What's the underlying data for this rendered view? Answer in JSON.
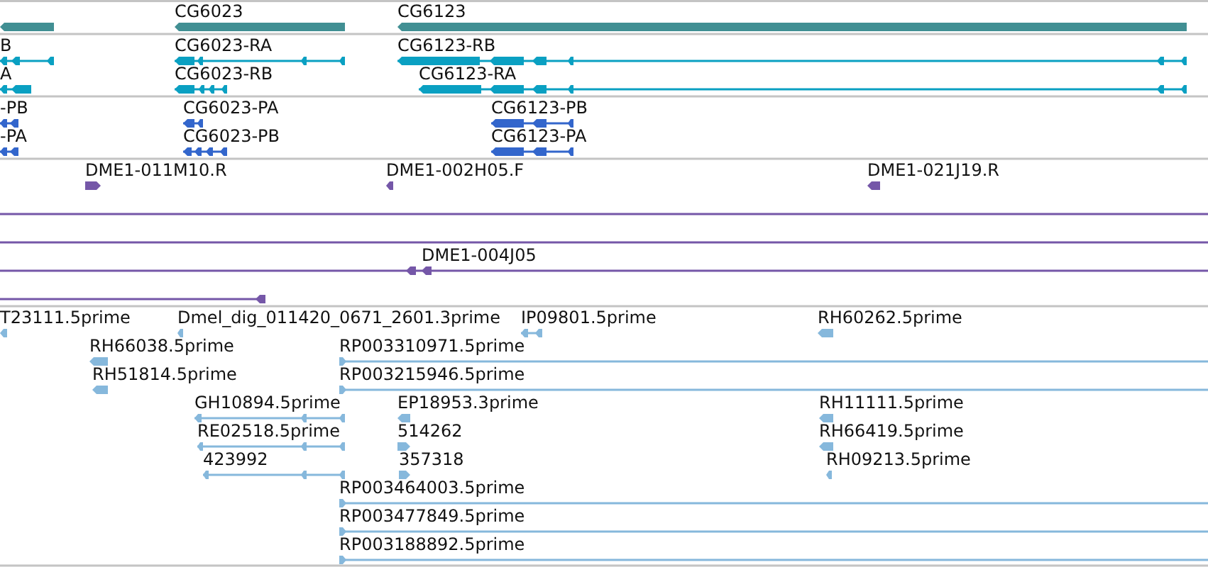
{
  "tracks": [
    {
      "kind": "gene",
      "features": [
        {
          "kind": "gene",
          "reverse": true
        },
        {
          "label": "CG6023",
          "kind": "gene",
          "reverse": true
        },
        {
          "label": "CG6123",
          "kind": "gene",
          "reverse": true
        }
      ]
    },
    {
      "kind": "transcript",
      "features": [
        {
          "label": "B",
          "kind": "spliced",
          "reverse": true
        },
        {
          "label": "A",
          "kind": "spliced",
          "reverse": true
        },
        {
          "label": "CG6023-RA",
          "kind": "spliced",
          "reverse": true
        },
        {
          "label": "CG6023-RB",
          "kind": "spliced",
          "reverse": true
        },
        {
          "label": "CG6123-RB",
          "kind": "spliced",
          "reverse": true
        },
        {
          "label": "CG6123-RA",
          "kind": "spliced",
          "reverse": true
        }
      ]
    },
    {
      "kind": "protein",
      "features": [
        {
          "label": "-PB",
          "kind": "spliced",
          "reverse": true
        },
        {
          "label": "-PA",
          "kind": "spliced",
          "reverse": true
        },
        {
          "label": "CG6023-PA",
          "kind": "spliced",
          "reverse": true
        },
        {
          "label": "CG6023-PB",
          "kind": "spliced",
          "reverse": true
        },
        {
          "label": "CG6123-PB",
          "kind": "spliced",
          "reverse": true
        },
        {
          "label": "CG6123-PA",
          "kind": "spliced",
          "reverse": true
        }
      ]
    },
    {
      "kind": "clone",
      "features": [
        {
          "label": "DME1-011M10.R",
          "kind": "marker",
          "reverse": false
        },
        {
          "label": "DME1-002H05.F",
          "kind": "marker",
          "reverse": true
        },
        {
          "label": "DME1-021J19.R",
          "kind": "marker",
          "reverse": true
        },
        {
          "kind": "spliced"
        },
        {
          "kind": "spliced"
        },
        {
          "label": "DME1-004J05",
          "kind": "spliced",
          "reverse": true
        },
        {
          "kind": "spliced",
          "reverse": true
        }
      ]
    },
    {
      "kind": "est",
      "features": [
        {
          "label": "T23111.5prime",
          "kind": "marker",
          "reverse": true
        },
        {
          "label": "Dmel_dig_011420_0671_2601.3prime",
          "kind": "marker",
          "reverse": true
        },
        {
          "label": "IP09801.5prime",
          "kind": "spliced",
          "reverse": true
        },
        {
          "label": "RH60262.5prime",
          "kind": "marker",
          "reverse": true
        },
        {
          "label": "RH66038.5prime",
          "kind": "marker",
          "reverse": true
        },
        {
          "label": "RP003310971.5prime",
          "kind": "spliced",
          "reverse": false
        },
        {
          "label": "RH51814.5prime",
          "kind": "marker",
          "reverse": true
        },
        {
          "label": "RP003215946.5prime",
          "kind": "spliced",
          "reverse": false
        },
        {
          "label": "GH10894.5prime",
          "kind": "spliced",
          "reverse": true
        },
        {
          "label": "EP18953.3prime",
          "kind": "marker",
          "reverse": true
        },
        {
          "label": "RH11111.5prime",
          "kind": "marker",
          "reverse": true
        },
        {
          "label": "RE02518.5prime",
          "kind": "spliced",
          "reverse": true
        },
        {
          "label": "514262",
          "kind": "marker",
          "reverse": false
        },
        {
          "label": "RH66419.5prime",
          "kind": "marker",
          "reverse": true
        },
        {
          "label": "423992",
          "kind": "spliced",
          "reverse": true
        },
        {
          "label": "357318",
          "kind": "marker",
          "reverse": false
        },
        {
          "label": "RH09213.5prime",
          "kind": "marker",
          "reverse": true
        },
        {
          "label": "RP003464003.5prime",
          "kind": "spliced",
          "reverse": false
        },
        {
          "label": "RP003477849.5prime",
          "kind": "spliced",
          "reverse": false
        },
        {
          "label": "RP003188892.5prime",
          "kind": "spliced",
          "reverse": false
        }
      ]
    }
  ]
}
